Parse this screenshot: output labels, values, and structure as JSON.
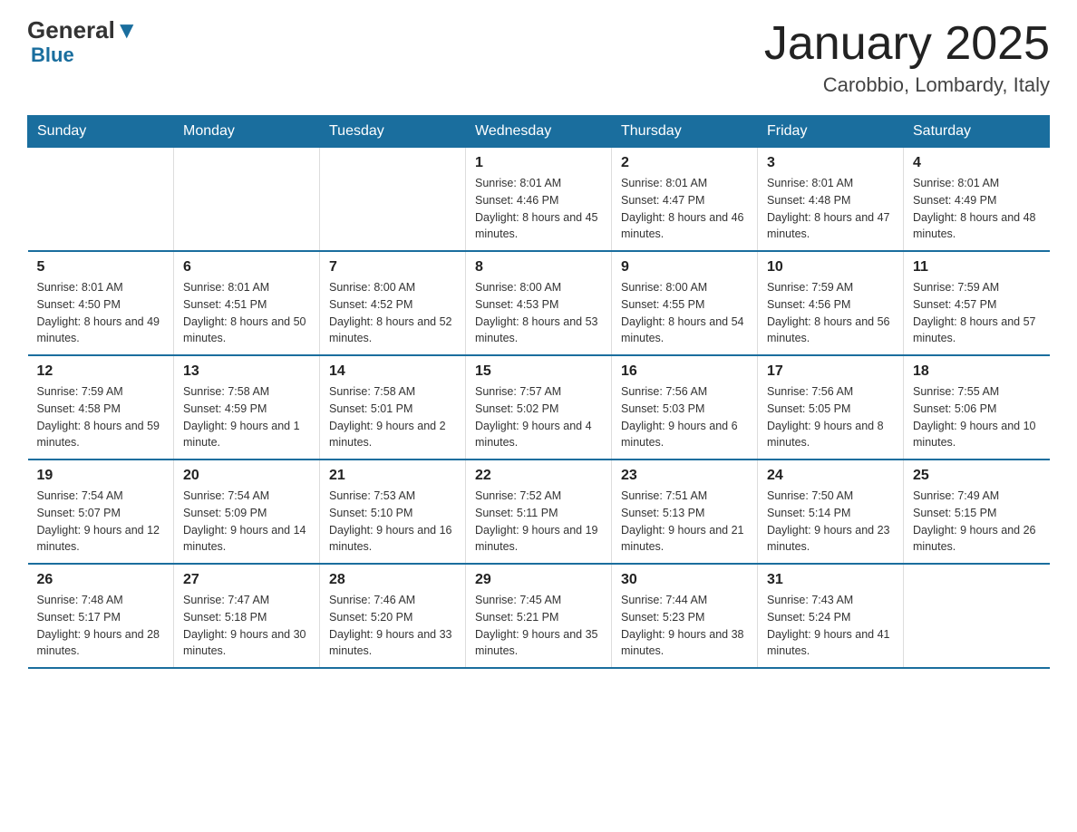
{
  "header": {
    "logo_general": "General",
    "logo_blue": "Blue",
    "month_title": "January 2025",
    "location": "Carobbio, Lombardy, Italy"
  },
  "days_of_week": [
    "Sunday",
    "Monday",
    "Tuesday",
    "Wednesday",
    "Thursday",
    "Friday",
    "Saturday"
  ],
  "weeks": [
    [
      {
        "day": "",
        "info": ""
      },
      {
        "day": "",
        "info": ""
      },
      {
        "day": "",
        "info": ""
      },
      {
        "day": "1",
        "info": "Sunrise: 8:01 AM\nSunset: 4:46 PM\nDaylight: 8 hours and 45 minutes."
      },
      {
        "day": "2",
        "info": "Sunrise: 8:01 AM\nSunset: 4:47 PM\nDaylight: 8 hours and 46 minutes."
      },
      {
        "day": "3",
        "info": "Sunrise: 8:01 AM\nSunset: 4:48 PM\nDaylight: 8 hours and 47 minutes."
      },
      {
        "day": "4",
        "info": "Sunrise: 8:01 AM\nSunset: 4:49 PM\nDaylight: 8 hours and 48 minutes."
      }
    ],
    [
      {
        "day": "5",
        "info": "Sunrise: 8:01 AM\nSunset: 4:50 PM\nDaylight: 8 hours and 49 minutes."
      },
      {
        "day": "6",
        "info": "Sunrise: 8:01 AM\nSunset: 4:51 PM\nDaylight: 8 hours and 50 minutes."
      },
      {
        "day": "7",
        "info": "Sunrise: 8:00 AM\nSunset: 4:52 PM\nDaylight: 8 hours and 52 minutes."
      },
      {
        "day": "8",
        "info": "Sunrise: 8:00 AM\nSunset: 4:53 PM\nDaylight: 8 hours and 53 minutes."
      },
      {
        "day": "9",
        "info": "Sunrise: 8:00 AM\nSunset: 4:55 PM\nDaylight: 8 hours and 54 minutes."
      },
      {
        "day": "10",
        "info": "Sunrise: 7:59 AM\nSunset: 4:56 PM\nDaylight: 8 hours and 56 minutes."
      },
      {
        "day": "11",
        "info": "Sunrise: 7:59 AM\nSunset: 4:57 PM\nDaylight: 8 hours and 57 minutes."
      }
    ],
    [
      {
        "day": "12",
        "info": "Sunrise: 7:59 AM\nSunset: 4:58 PM\nDaylight: 8 hours and 59 minutes."
      },
      {
        "day": "13",
        "info": "Sunrise: 7:58 AM\nSunset: 4:59 PM\nDaylight: 9 hours and 1 minute."
      },
      {
        "day": "14",
        "info": "Sunrise: 7:58 AM\nSunset: 5:01 PM\nDaylight: 9 hours and 2 minutes."
      },
      {
        "day": "15",
        "info": "Sunrise: 7:57 AM\nSunset: 5:02 PM\nDaylight: 9 hours and 4 minutes."
      },
      {
        "day": "16",
        "info": "Sunrise: 7:56 AM\nSunset: 5:03 PM\nDaylight: 9 hours and 6 minutes."
      },
      {
        "day": "17",
        "info": "Sunrise: 7:56 AM\nSunset: 5:05 PM\nDaylight: 9 hours and 8 minutes."
      },
      {
        "day": "18",
        "info": "Sunrise: 7:55 AM\nSunset: 5:06 PM\nDaylight: 9 hours and 10 minutes."
      }
    ],
    [
      {
        "day": "19",
        "info": "Sunrise: 7:54 AM\nSunset: 5:07 PM\nDaylight: 9 hours and 12 minutes."
      },
      {
        "day": "20",
        "info": "Sunrise: 7:54 AM\nSunset: 5:09 PM\nDaylight: 9 hours and 14 minutes."
      },
      {
        "day": "21",
        "info": "Sunrise: 7:53 AM\nSunset: 5:10 PM\nDaylight: 9 hours and 16 minutes."
      },
      {
        "day": "22",
        "info": "Sunrise: 7:52 AM\nSunset: 5:11 PM\nDaylight: 9 hours and 19 minutes."
      },
      {
        "day": "23",
        "info": "Sunrise: 7:51 AM\nSunset: 5:13 PM\nDaylight: 9 hours and 21 minutes."
      },
      {
        "day": "24",
        "info": "Sunrise: 7:50 AM\nSunset: 5:14 PM\nDaylight: 9 hours and 23 minutes."
      },
      {
        "day": "25",
        "info": "Sunrise: 7:49 AM\nSunset: 5:15 PM\nDaylight: 9 hours and 26 minutes."
      }
    ],
    [
      {
        "day": "26",
        "info": "Sunrise: 7:48 AM\nSunset: 5:17 PM\nDaylight: 9 hours and 28 minutes."
      },
      {
        "day": "27",
        "info": "Sunrise: 7:47 AM\nSunset: 5:18 PM\nDaylight: 9 hours and 30 minutes."
      },
      {
        "day": "28",
        "info": "Sunrise: 7:46 AM\nSunset: 5:20 PM\nDaylight: 9 hours and 33 minutes."
      },
      {
        "day": "29",
        "info": "Sunrise: 7:45 AM\nSunset: 5:21 PM\nDaylight: 9 hours and 35 minutes."
      },
      {
        "day": "30",
        "info": "Sunrise: 7:44 AM\nSunset: 5:23 PM\nDaylight: 9 hours and 38 minutes."
      },
      {
        "day": "31",
        "info": "Sunrise: 7:43 AM\nSunset: 5:24 PM\nDaylight: 9 hours and 41 minutes."
      },
      {
        "day": "",
        "info": ""
      }
    ]
  ]
}
